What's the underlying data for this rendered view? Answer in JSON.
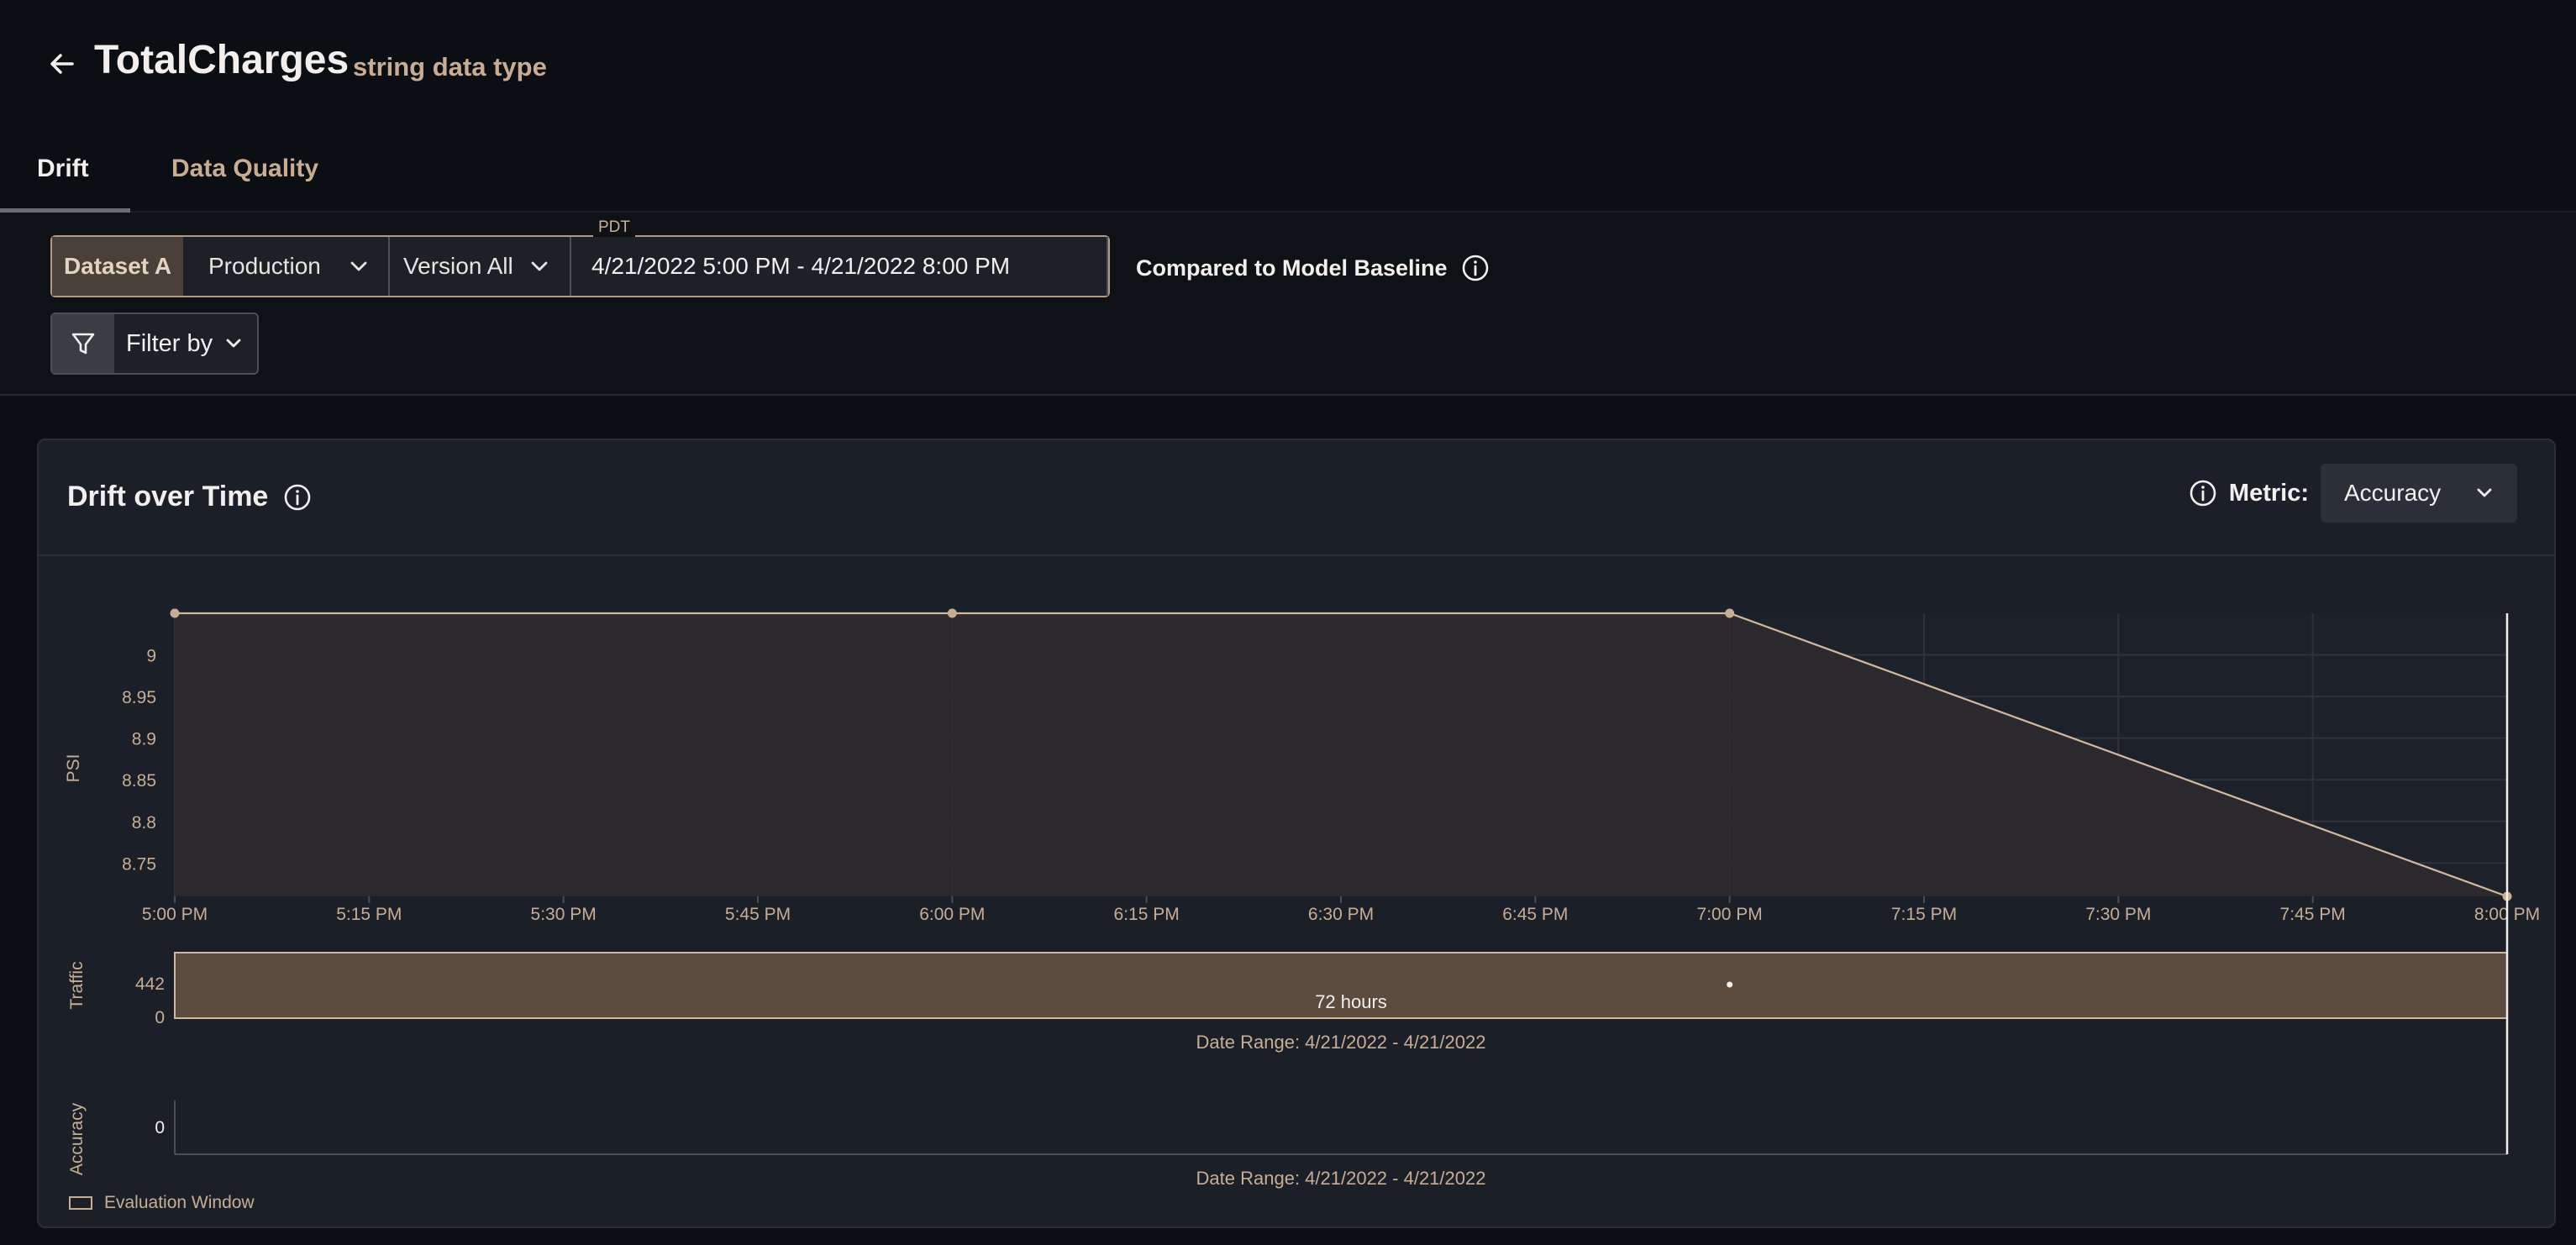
{
  "header": {
    "title": "TotalCharges",
    "subtitle": "string data type"
  },
  "tabs": [
    {
      "label": "Drift",
      "active": true
    },
    {
      "label": "Data Quality",
      "active": false
    }
  ],
  "filters": {
    "dataset_label": "Dataset A",
    "environment": "Production",
    "version": "Version All",
    "timezone": "PDT",
    "date_range": "4/21/2022 5:00 PM - 4/21/2022 8:00 PM",
    "compared_to": "Compared to Model Baseline",
    "filter_by": "Filter by"
  },
  "card": {
    "title": "Drift over Time",
    "metric_label": "Metric:",
    "metric_value": "Accuracy"
  },
  "colors": {
    "accent": "#c9ad92",
    "line": "#d2b89e",
    "traffic_fill": "#5c4c40",
    "card_bg": "#1b2028"
  },
  "chart_data": [
    {
      "type": "area",
      "ylabel": "PSI",
      "x": [
        "5:00 PM",
        "6:00 PM",
        "7:00 PM",
        "8:00 PM"
      ],
      "values": [
        9.05,
        9.05,
        9.05,
        8.71
      ],
      "xticks": [
        "5:00 PM",
        "5:15 PM",
        "5:30 PM",
        "5:45 PM",
        "6:00 PM",
        "6:15 PM",
        "6:30 PM",
        "6:45 PM",
        "7:00 PM",
        "7:15 PM",
        "7:30 PM",
        "7:45 PM",
        "8:00 PM"
      ],
      "yticks": [
        8.75,
        8.8,
        8.85,
        8.9,
        8.95,
        9
      ],
      "ytick_labels": [
        "8.75",
        "8.8",
        "8.85",
        "8.9",
        "8.95",
        "9"
      ],
      "ylim": [
        8.71,
        9.05
      ],
      "grid": true
    },
    {
      "type": "bar",
      "ylabel": "Traffic",
      "yticks": [
        0,
        442
      ],
      "ytick_labels": [
        "0",
        "442"
      ],
      "bar_label": "72 hours",
      "value": 442,
      "marker_x": "7:00 PM",
      "footer": "Date Range: 4/21/2022 - 4/21/2022"
    },
    {
      "type": "line",
      "ylabel": "Accuracy",
      "yticks": [
        0
      ],
      "ytick_labels": [
        "0"
      ],
      "footer": "Date Range: 4/21/2022 - 4/21/2022"
    }
  ],
  "legend": {
    "label": "Evaluation Window"
  }
}
